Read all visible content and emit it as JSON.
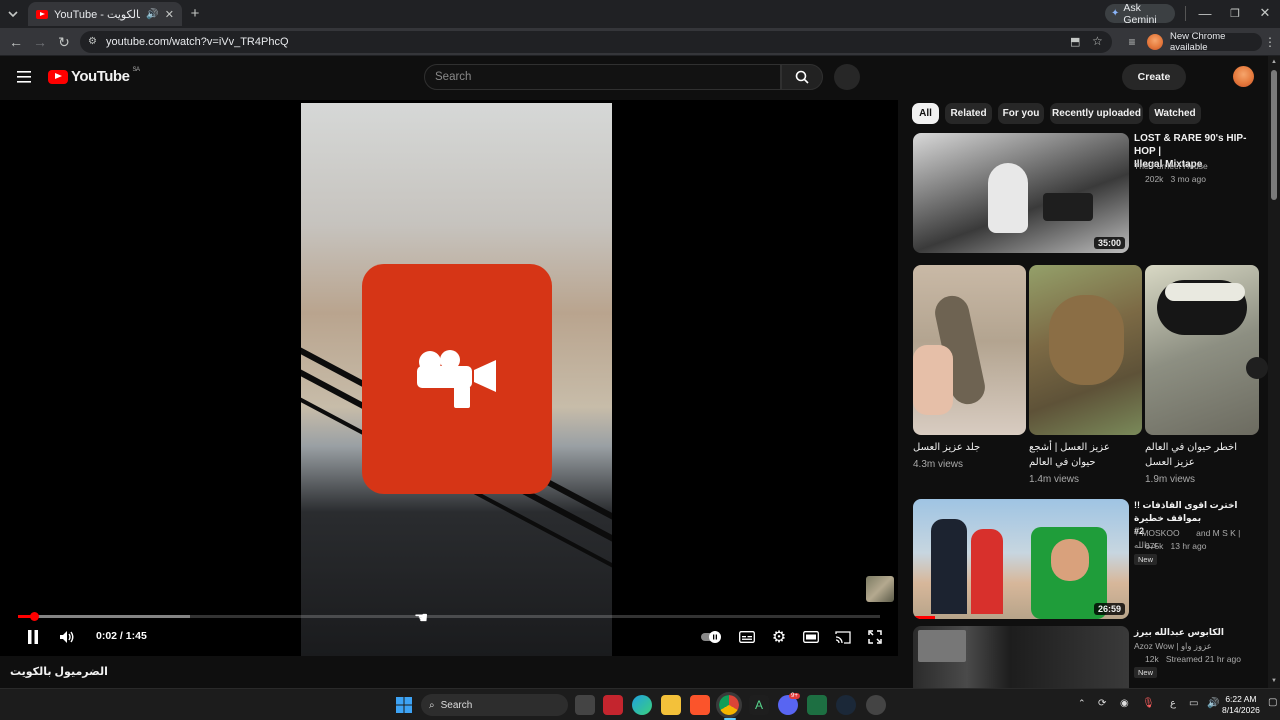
{
  "browser": {
    "tab_title": "YouTube - الضرميول بالكويت",
    "url": "youtube.com/watch?v=iVv_TR4PhcQ",
    "ask_gemini": "Ask Gemini",
    "new_chrome": "New Chrome available"
  },
  "masthead": {
    "logo_text": "YouTube",
    "country_code": "SA",
    "search_placeholder": "Search",
    "create_label": "Create"
  },
  "player": {
    "time_current": "0:02",
    "time_separator": " / ",
    "time_total": "1:45",
    "progress_fraction": 0.019,
    "buffered_fraction": 0.2,
    "video_title": "الضرميول بالكويت"
  },
  "chips": [
    "All",
    "Related",
    "For you",
    "Recently uploaded",
    "Watched"
  ],
  "recommendations": [
    {
      "title_line1": "LOST & RARE 90's HIP-HOP |",
      "title_line2": "Illegal Mixtape",
      "channel": "The Purrfect House",
      "views": "202k",
      "age": "3 mo ago",
      "duration": "35:00"
    },
    {
      "title_line1": "!! اخترت اقوى القاذفات بمواقف خطيرة",
      "title_line2": "#2",
      "channel": "+ MOSKOO",
      "channel2": "and M S K | عبدالله",
      "views": "675k",
      "age": "13 hr ago",
      "badge": "New",
      "duration": "26:59"
    },
    {
      "title_line1": "الكابوس عبدالله بيرز",
      "channel": "Azoz Wow | عزوز واو",
      "views": "12k",
      "age": "Streamed 21 hr ago",
      "badge": "New"
    }
  ],
  "shorts": [
    {
      "title_line1": "جلد عزيز العسل",
      "title_line2": "",
      "views": "4.3m views"
    },
    {
      "title_line1": "عزيز العسل | أشجع",
      "title_line2": "حيوان في العالم",
      "views": "1.4m views"
    },
    {
      "title_line1": "اخطر حيوان في العالم",
      "title_line2": "عزيز العسل",
      "views": "1.9m views"
    }
  ],
  "taskbar": {
    "search_label": "Search",
    "time": "6:22 AM",
    "date": "8/14/2026",
    "discord_badge": "9+"
  },
  "colors": {
    "yt_red": "#ff0000",
    "badge_orange": "#d63516",
    "bg": "#0f0f0f"
  }
}
